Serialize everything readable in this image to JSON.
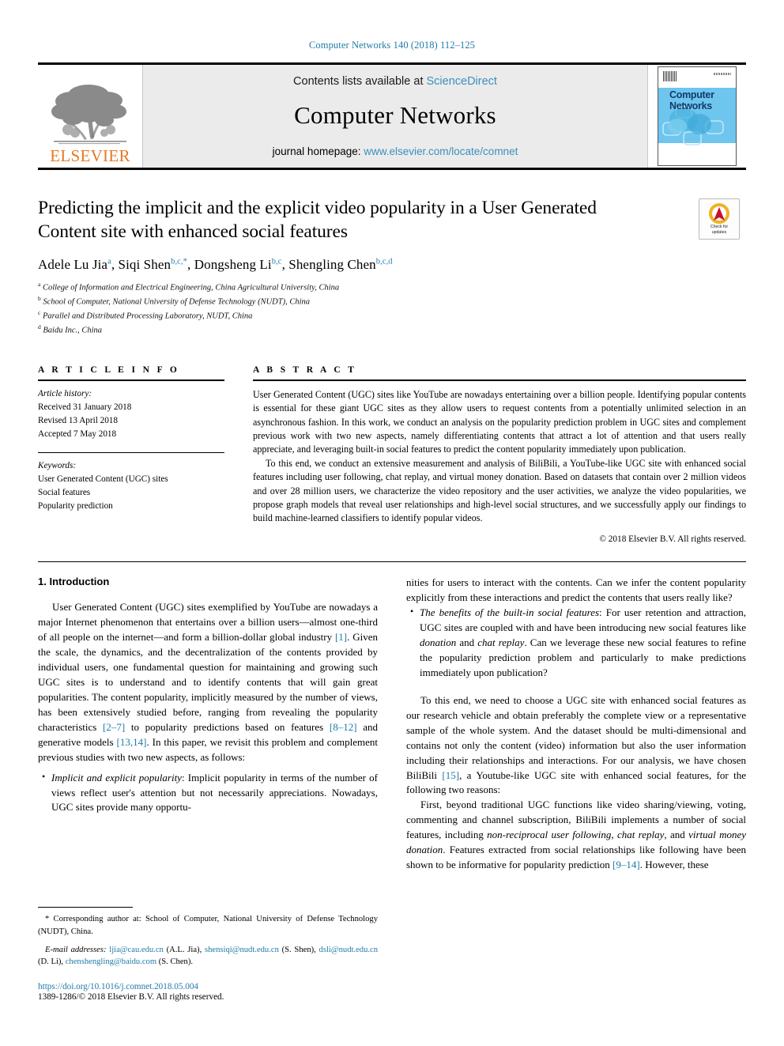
{
  "running_head": "Computer Networks 140 (2018) 112–125",
  "masthead": {
    "publisher_name": "ELSEVIER",
    "contents_prefix": "Contents lists available at ",
    "contents_link": "ScienceDirect",
    "journal_name": "Computer Networks",
    "homepage_prefix": "journal homepage: ",
    "homepage_url": "www.elsevier.com/locate/comnet",
    "cover_title_line1": "Computer",
    "cover_title_line2": "Networks"
  },
  "title": "Predicting the implicit and the explicit video popularity in a User Generated Content site with enhanced social features",
  "crossmark": {
    "line1": "Check for",
    "line2": "updates"
  },
  "authors": [
    {
      "name": "Adele Lu Jia",
      "sup": "a"
    },
    {
      "name": "Siqi Shen",
      "sup": "b,c,*"
    },
    {
      "name": "Dongsheng Li",
      "sup": "b,c"
    },
    {
      "name": "Shengling Chen",
      "sup": "b,c,d"
    }
  ],
  "affiliations": [
    {
      "mark": "a",
      "text": "College of Information and Electrical Engineering, China Agricultural University, China"
    },
    {
      "mark": "b",
      "text": "School of Computer, National University of Defense Technology (NUDT), China"
    },
    {
      "mark": "c",
      "text": "Parallel and Distributed Processing Laboratory, NUDT, China"
    },
    {
      "mark": "d",
      "text": "Baidu Inc., China"
    }
  ],
  "article_info": {
    "heading": "A R T I C L E   I N F O",
    "history_label": "Article history:",
    "history": [
      "Received 31 January 2018",
      "Revised 13 April 2018",
      "Accepted 7 May 2018"
    ],
    "keywords_label": "Keywords:",
    "keywords": [
      "User Generated Content (UGC) sites",
      "Social features",
      "Popularity prediction"
    ]
  },
  "abstract": {
    "heading": "A B S T R A C T",
    "paragraphs": [
      "User Generated Content (UGC) sites like YouTube are nowadays entertaining over a billion people. Identifying popular contents is essential for these giant UGC sites as they allow users to request contents from a potentially unlimited selection in an asynchronous fashion. In this work, we conduct an analysis on the popularity prediction problem in UGC sites and complement previous work with two new aspects, namely differentiating contents that attract a lot of attention and that users really appreciate, and leveraging built-in social features to predict the content popularity immediately upon publication.",
      "To this end, we conduct an extensive measurement and analysis of BiliBili, a YouTube-like UGC site with enhanced social features including user following, chat replay, and virtual money donation. Based on datasets that contain over 2 million videos and over 28 million users, we characterize the video repository and the user activities, we analyze the video popularities, we propose graph models that reveal user relationships and high-level social structures, and we successfully apply our findings to build machine-learned classifiers to identify popular videos."
    ],
    "copyright": "© 2018 Elsevier B.V. All rights reserved."
  },
  "body": {
    "section_number_title": "1. Introduction",
    "left_p1_a": "User Generated Content (UGC) sites exemplified by YouTube are nowadays a major Internet phenomenon that entertains over a billion users—almost one-third of all people on the internet—and form a billion-dollar global industry ",
    "left_p1_ref1": "[1]",
    "left_p1_b": ". Given the scale, the dynamics, and the decentralization of the contents provided by individual users, one fundamental question for maintaining and growing such UGC sites is to understand and to identify contents that will gain great popularities. The content popularity, implicitly measured by the number of views, has been extensively studied before, ranging from revealing the popularity characteristics ",
    "left_p1_ref2": "[2–7]",
    "left_p1_c": " to popularity predictions based on features ",
    "left_p1_ref3": "[8–12]",
    "left_p1_d": " and generative models ",
    "left_p1_ref4": "[13,14]",
    "left_p1_e": ". In this paper, we revisit this problem and complement previous studies with two new aspects, as follows:",
    "bullet1_lead": "Implicit and explicit popularity",
    "bullet1_text": ": Implicit popularity in terms of the number of views reflect user's attention but not necessarily appreciations. Nowadays, UGC sites provide many opportu-",
    "right_cont": "nities for users to interact with the contents. Can we infer the content popularity explicitly from these interactions and predict the contents that users really like?",
    "bullet2_lead": "The benefits of the built-in social features",
    "bullet2_a": ": For user retention and attraction, UGC sites are coupled with and have been introducing new social features like ",
    "bullet2_it1": "donation",
    "bullet2_b": " and ",
    "bullet2_it2": "chat replay",
    "bullet2_c": ". Can we leverage these new social features to refine the popularity prediction problem and particularly to make predictions immediately upon publication?",
    "right_p2_a": "To this end, we need to choose a UGC site with enhanced social features as our research vehicle and obtain preferably the complete view or a representative sample of the whole system. And the dataset should be multi-dimensional and contains not only the content (video) information but also the user information including their relationships and interactions. For our analysis, we have chosen BiliBili ",
    "right_p2_ref": "[15]",
    "right_p2_b": ", a Youtube-like UGC site with enhanced social features, for the following two reasons:",
    "right_p3_a": "First, beyond traditional UGC functions like video sharing/viewing, voting, commenting and channel subscription, BiliBili implements a number of social features, including ",
    "right_p3_it1": "non-reciprocal user following",
    "right_p3_b": ", ",
    "right_p3_it2": "chat replay",
    "right_p3_c": ", and ",
    "right_p3_it3": "virtual money donation",
    "right_p3_d": ". Features extracted from social relationships like following have been shown to be informative for popularity prediction ",
    "right_p3_ref": "[9–14]",
    "right_p3_e": ". However, these"
  },
  "footnotes": {
    "corresponding_mark": "*",
    "corresponding_text": " Corresponding author at: School of Computer, National University of Defense Technology (NUDT), China.",
    "email_label": "E-mail addresses:",
    "emails": [
      {
        "address": "ljia@cau.edu.cn",
        "person": "(A.L. Jia)"
      },
      {
        "address": "shensiqi@nudt.edu.cn",
        "person": "(S. Shen)"
      },
      {
        "address": "dsli@nudt.edu.cn",
        "person": "(D. Li)"
      },
      {
        "address": "chenshengling@baidu.com",
        "person": "(S. Chen)"
      }
    ],
    "doi": "https://doi.org/10.1016/j.comnet.2018.05.004",
    "issn_line": "1389-1286/© 2018 Elsevier B.V. All rights reserved."
  },
  "colors": {
    "link": "#1f7aa8",
    "elsevier_orange": "#E87722",
    "cover_blue": "#6ec6ee"
  }
}
